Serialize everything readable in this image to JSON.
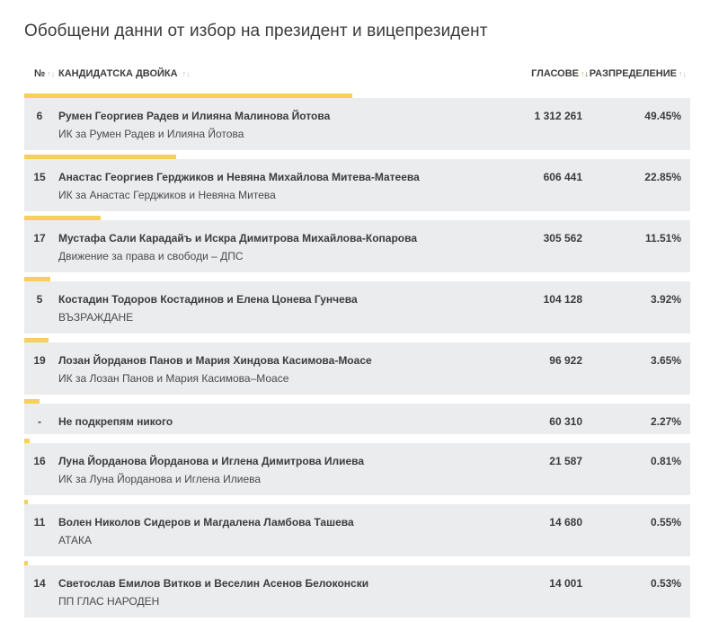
{
  "title": "Обобщени данни от избор на президент и вицепрезидент",
  "header": {
    "num": "№",
    "candidates": "Кандидатска двойка",
    "votes": "Гласове",
    "distribution": "Разпределение",
    "sort_icon": "↑↓"
  },
  "colors": {
    "bar": "#f7cf5a",
    "row_bg": "#eaecee",
    "sort_active": "#e6b800"
  },
  "rows": [
    {
      "num": "6",
      "candidates": "Румен Георгиев Радев и Илияна Малинова Йотова",
      "party": "ИК за Румен Радев и Илияна Йотова",
      "votes": "1 312 261",
      "pct": "49.45%",
      "share": 49.45
    },
    {
      "num": "15",
      "candidates": "Анастас Георгиев Герджиков и Невяна Михайлова Митева-Матеева",
      "party": "ИК за Анастас Герджиков и Невяна Митева",
      "votes": "606 441",
      "pct": "22.85%",
      "share": 22.85
    },
    {
      "num": "17",
      "candidates": "Мустафа Сали Карадайъ и Искра Димитрова Михайлова-Копарова",
      "party": "Движение за права и свободи – ДПС",
      "votes": "305 562",
      "pct": "11.51%",
      "share": 11.51
    },
    {
      "num": "5",
      "candidates": "Костадин Тодоров Костадинов и Елена Цонева Гунчева",
      "party": "ВЪЗРАЖДАНЕ",
      "votes": "104 128",
      "pct": "3.92%",
      "share": 3.92
    },
    {
      "num": "19",
      "candidates": "Лозан Йорданов Панов и Мария Хиндова Касимова-Моасе",
      "party": "ИК за Лозан Панов и Мария Касимова–Моасе",
      "votes": "96 922",
      "pct": "3.65%",
      "share": 3.65
    },
    {
      "num": "-",
      "candidates": "Не подкрепям никого",
      "party": "",
      "votes": "60 310",
      "pct": "2.27%",
      "share": 2.27
    },
    {
      "num": "16",
      "candidates": "Луна Йорданова Йорданова и Иглена Димитрова Илиева",
      "party": "ИК за Луна Йорданова и Иглена Илиева",
      "votes": "21 587",
      "pct": "0.81%",
      "share": 0.81
    },
    {
      "num": "11",
      "candidates": "Волен Николов Сидеров и Магдалена Ламбова Ташева",
      "party": "АТАКА",
      "votes": "14 680",
      "pct": "0.55%",
      "share": 0.55
    },
    {
      "num": "14",
      "candidates": "Светослав Емилов Витков и Веселин Асенов Белоконски",
      "party": "ПП ГЛАС НАРОДЕН",
      "votes": "14 001",
      "pct": "0.53%",
      "share": 0.53
    }
  ]
}
